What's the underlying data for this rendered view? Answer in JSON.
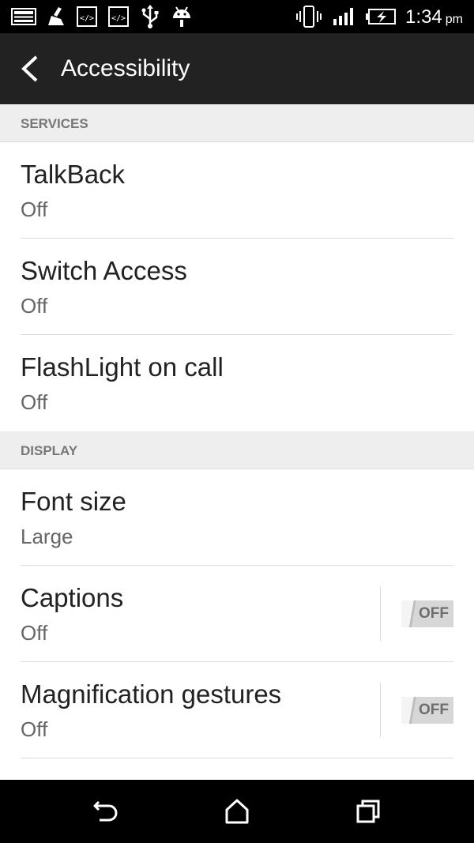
{
  "status_bar": {
    "time": "1:34",
    "ampm": "pm",
    "icons": [
      "gallery-icon",
      "cleaner-icon",
      "code-icon",
      "code-icon",
      "usb-icon",
      "android-icon",
      "vibrate-icon",
      "signal-icon",
      "battery-charging-icon"
    ]
  },
  "app_bar": {
    "title": "Accessibility",
    "back_icon": "back-arrow-icon"
  },
  "sections": [
    {
      "header": "SERVICES",
      "items": [
        {
          "title": "TalkBack",
          "subtitle": "Off"
        },
        {
          "title": "Switch Access",
          "subtitle": "Off"
        },
        {
          "title": "FlashLight on call",
          "subtitle": "Off"
        }
      ]
    },
    {
      "header": "DISPLAY",
      "items": [
        {
          "title": "Font size",
          "subtitle": "Large"
        },
        {
          "title": "Captions",
          "subtitle": "Off",
          "toggle": "OFF"
        },
        {
          "title": "Magnification gestures",
          "subtitle": "Off",
          "toggle": "OFF"
        }
      ]
    }
  ],
  "nav_bar": {
    "icons": [
      "back-icon",
      "home-icon",
      "recent-apps-icon"
    ]
  },
  "colors": {
    "status_bar": "#000000",
    "app_bar": "#222222",
    "section_header": "#eeeeee",
    "nav_bar": "#000000"
  }
}
